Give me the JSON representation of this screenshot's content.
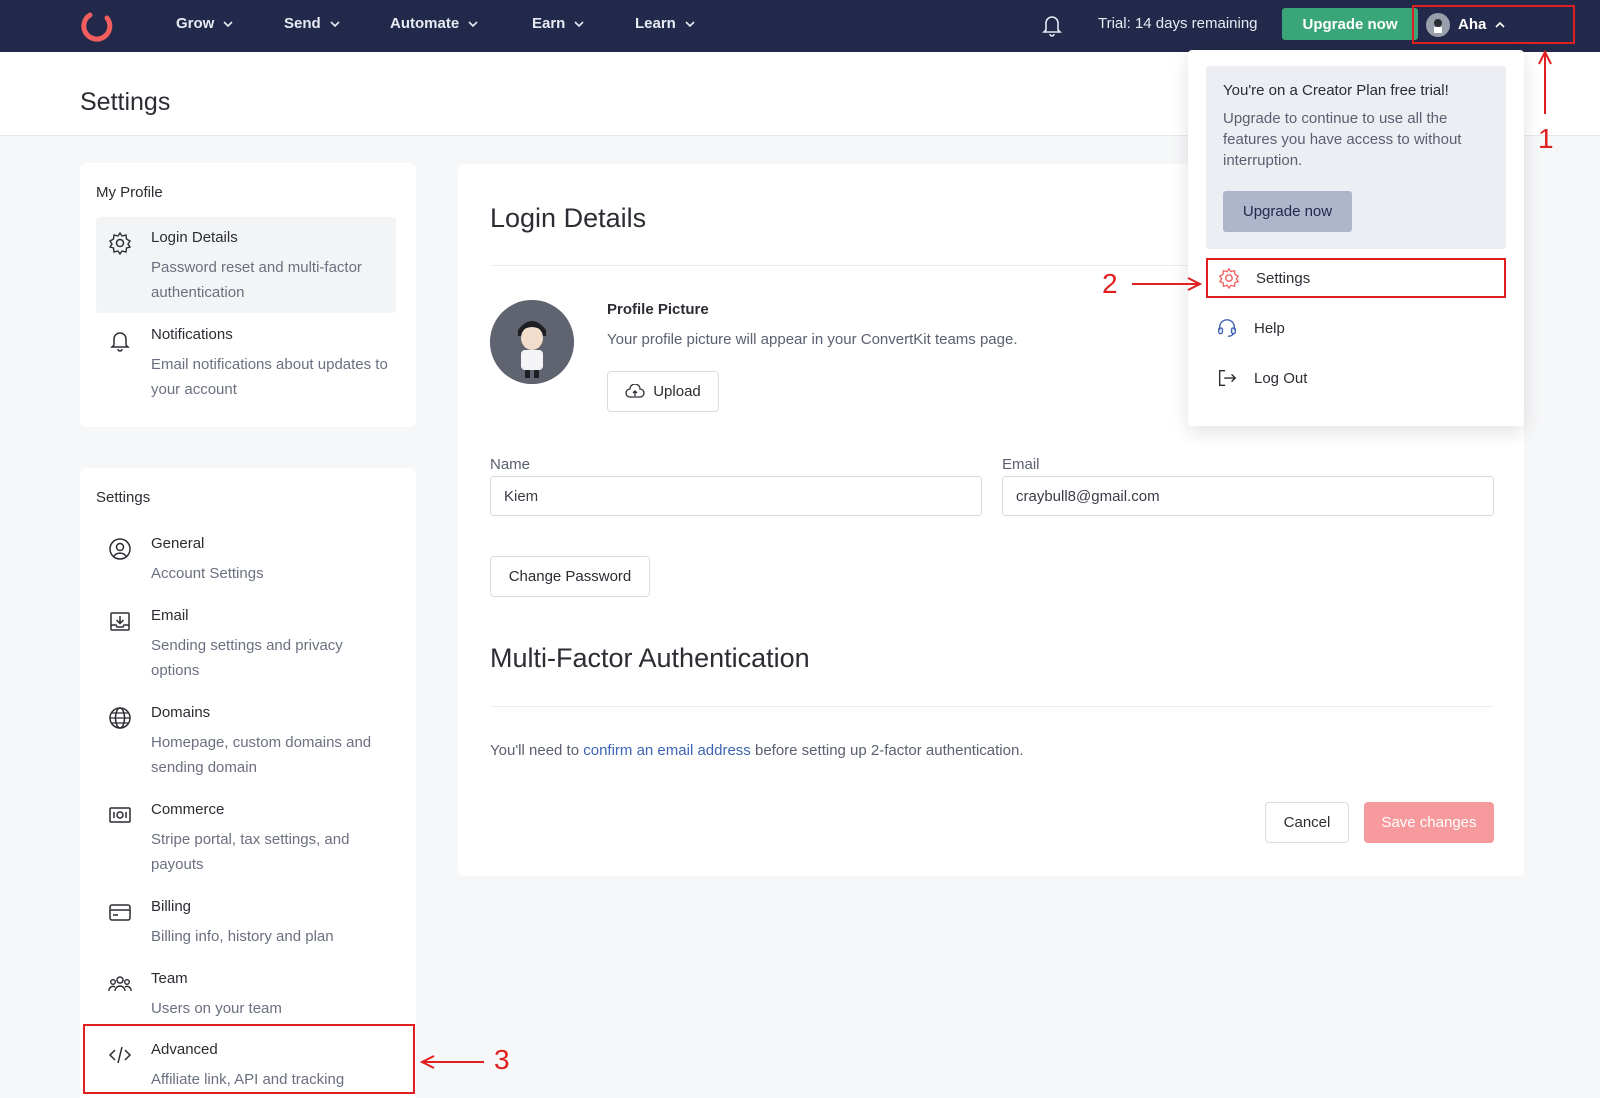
{
  "nav": {
    "items": [
      "Grow",
      "Send",
      "Automate",
      "Earn",
      "Learn"
    ],
    "trial_text": "Trial: 14 days remaining",
    "upgrade_label": "Upgrade now",
    "user_name": "Aha"
  },
  "page": {
    "title": "Settings"
  },
  "sidebar": {
    "profile_title": "My Profile",
    "profile_items": [
      {
        "title": "Login Details",
        "desc": "Password reset and multi-factor authentication",
        "icon": "gear-icon"
      },
      {
        "title": "Notifications",
        "desc": "Email notifications about updates to your account",
        "icon": "bell-icon"
      }
    ],
    "settings_title": "Settings",
    "settings_items": [
      {
        "title": "General",
        "desc": "Account Settings",
        "icon": "user-circle-icon"
      },
      {
        "title": "Email",
        "desc": "Sending settings and privacy options",
        "icon": "inbox-download-icon"
      },
      {
        "title": "Domains",
        "desc": "Homepage, custom domains and sending domain",
        "icon": "globe-icon"
      },
      {
        "title": "Commerce",
        "desc": "Stripe portal, tax settings, and payouts",
        "icon": "banknote-icon"
      },
      {
        "title": "Billing",
        "desc": "Billing info, history and plan",
        "icon": "credit-card-icon"
      },
      {
        "title": "Team",
        "desc": "Users on your team",
        "icon": "team-icon"
      },
      {
        "title": "Advanced",
        "desc": "Affiliate link, API and tracking",
        "icon": "code-icon"
      }
    ]
  },
  "main": {
    "heading": "Login Details",
    "profile_picture_title": "Profile Picture",
    "profile_picture_desc": "Your profile picture will appear in your ConvertKit teams page.",
    "upload_label": "Upload",
    "name_label": "Name",
    "name_value": "Kiem",
    "email_label": "Email",
    "email_value": "craybull8@gmail.com",
    "change_password_label": "Change Password",
    "mfa_heading": "Multi-Factor Authentication",
    "mfa_text_before": "You'll need to ",
    "mfa_link": "confirm an email address",
    "mfa_text_after": " before setting up 2-factor authentication.",
    "cancel_label": "Cancel",
    "save_label": "Save changes"
  },
  "dropdown": {
    "trial_title": "You're on a Creator Plan free trial!",
    "trial_text": "Upgrade to continue to use all the features you have access to without interruption.",
    "upgrade_label": "Upgrade now",
    "items": [
      {
        "label": "Settings",
        "icon": "gear-icon"
      },
      {
        "label": "Help",
        "icon": "headset-icon"
      },
      {
        "label": "Log Out",
        "icon": "logout-icon"
      }
    ]
  },
  "annotations": [
    "1",
    "2",
    "3"
  ],
  "colors": {
    "nav_bg": "#22294a",
    "accent_green": "#3aa579",
    "accent_red": "#e02020",
    "save_pink": "#f79a9d"
  }
}
